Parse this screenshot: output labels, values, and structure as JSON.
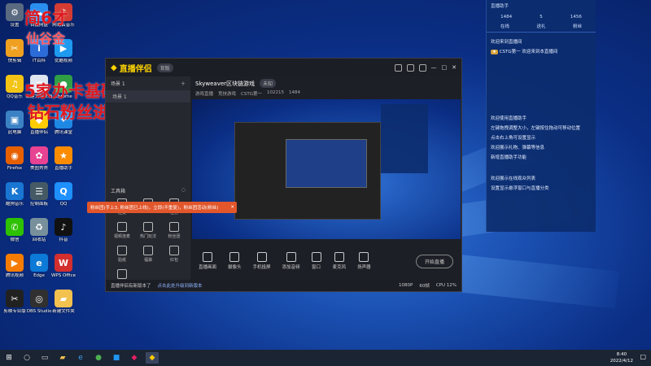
{
  "desktop_icons": [
    {
      "label": "设置",
      "color": "#5a6a80",
      "sym": "⚙"
    },
    {
      "label": "百度网盘",
      "color": "#2a8ef0",
      "sym": "☁"
    },
    {
      "label": "网易云音乐",
      "color": "#d43c33",
      "sym": "♪"
    },
    {
      "label": "快剪辑",
      "color": "#f0a020",
      "sym": "✂"
    },
    {
      "label": "IT百科",
      "color": "#2b6cd8",
      "sym": "i"
    },
    {
      "label": "优酷视频",
      "color": "#1e9af0",
      "sym": "▶"
    },
    {
      "label": "QQ音乐",
      "color": "#f3c415",
      "sym": "♫"
    },
    {
      "label": "新建文本文档",
      "color": "#dfe6ef",
      "sym": "≡"
    },
    {
      "label": "Chrome",
      "color": "#2f9e44",
      "sym": "●"
    },
    {
      "label": "此电脑",
      "color": "#3b82c4",
      "sym": "▣"
    },
    {
      "label": "直播伴侣",
      "color": "#ffcc00",
      "sym": "◆"
    },
    {
      "label": "腾讯课堂",
      "color": "#1e88e5",
      "sym": "✦"
    },
    {
      "label": "Firefox",
      "color": "#e66000",
      "sym": "◉"
    },
    {
      "label": "美图秀秀",
      "color": "#e84393",
      "sym": "✿"
    },
    {
      "label": "直播助手",
      "color": "#fb8c00",
      "sym": "★"
    },
    {
      "label": "酷狗音乐",
      "color": "#1976d2",
      "sym": "K"
    },
    {
      "label": "控制面板",
      "color": "#455a64",
      "sym": "☰"
    },
    {
      "label": "QQ",
      "color": "#1e90ff",
      "sym": "Q"
    },
    {
      "label": "微信",
      "color": "#2dc100",
      "sym": "✆"
    },
    {
      "label": "回收站",
      "color": "#78909c",
      "sym": "♻"
    },
    {
      "label": "抖音",
      "color": "#111111",
      "sym": "♪"
    },
    {
      "label": "腾讯视频",
      "color": "#f57c00",
      "sym": "▶"
    },
    {
      "label": "Edge",
      "color": "#0c7ad6",
      "sym": "e"
    },
    {
      "label": "WPS Office",
      "color": "#d32f2f",
      "sym": "W"
    },
    {
      "label": "剪映专业版",
      "color": "#212121",
      "sym": "✂"
    },
    {
      "label": "OBS Studio",
      "color": "#303030",
      "sym": "◎"
    },
    {
      "label": "新建文件夹",
      "color": "#f2c14e",
      "sym": "▰"
    }
  ],
  "overlay": {
    "line1": "简6才",
    "line2": "仙谷金",
    "line3": "5家办卡基础教学",
    "line4": "钻石粉丝进群"
  },
  "app": {
    "logo": "直播伴侣",
    "version": "官版",
    "stream_title": "Skyweaver区块链游戏",
    "tag": "未知",
    "sub_tags": [
      "游戏直播",
      "竞技游戏"
    ],
    "stats": [
      "CSTG第一",
      "102215",
      "1484"
    ],
    "scenes_header": "场景 1",
    "scene_item": "场景 1",
    "tools_header": "工具箱",
    "tools": [
      "连麦",
      "PK",
      "任务",
      "视频连麦",
      "热门玩法",
      "粉丝团",
      "贴纸",
      "福袋",
      "红包",
      "更多"
    ],
    "bottom": [
      "直播画面",
      "摄像头",
      "手机投屏",
      "添加音频",
      "窗口",
      "麦克风",
      "扬声器"
    ],
    "go_live": "开始直播",
    "status_left": "直播伴侣有新版本了",
    "status_mid": "点击此处升级到新版本",
    "status_right": [
      "1080P",
      "60帧",
      "CPU 12%"
    ],
    "toast": "粉丝团(手上3, 粉丝团已上线)，立即(不重复)，粉丝团活动(粉丝)"
  },
  "right_panel": {
    "header": "直播助手",
    "stats": [
      "1484",
      "5",
      "1456"
    ],
    "tabs": [
      "在线",
      "送礼",
      "粉丝"
    ],
    "messages": [
      "欢迎来到直播间",
      "CSTG第一 欢迎来到本直播间",
      "欢迎使用直播助手",
      "左键拖拽调整大小，左键按住拖动可移动位置",
      "点击右上角可设置显示",
      "欢迎展示礼物、弹幕等信息",
      "新增直播助手功能",
      "欢迎展示在线观众列表",
      "设置显示悬浮窗口与直播分类"
    ]
  },
  "taskbar": {
    "time": "8:40",
    "date": "2022/4/12"
  }
}
